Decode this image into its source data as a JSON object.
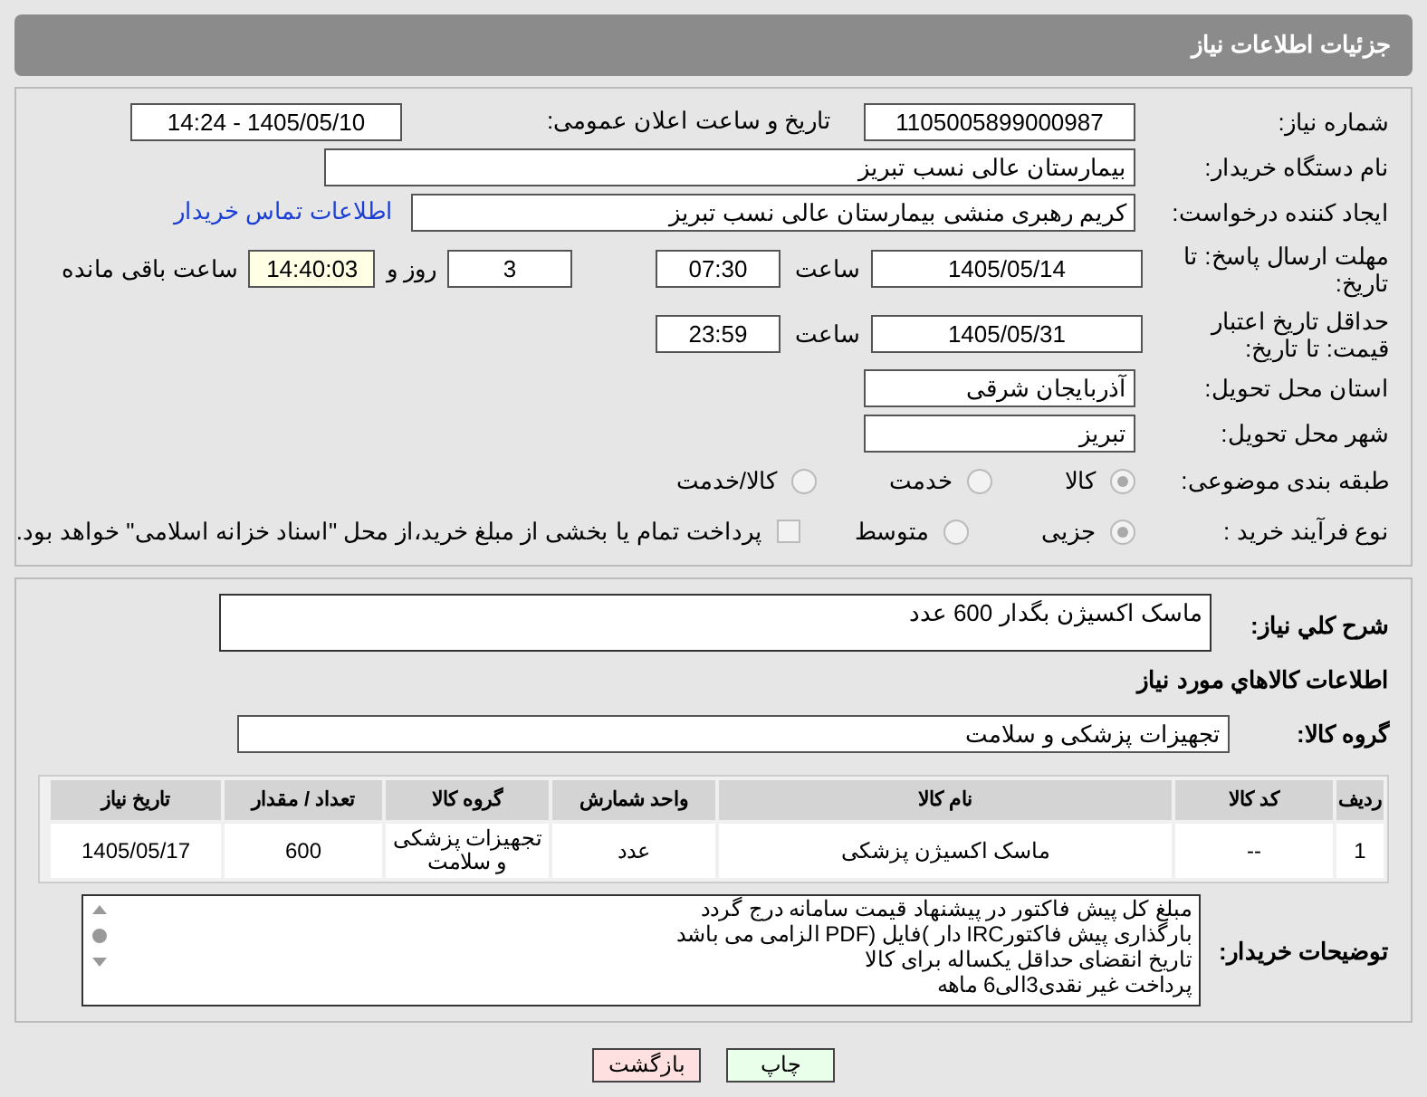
{
  "header": {
    "title": "جزئیات اطلاعات نیاز"
  },
  "details": {
    "need_number": {
      "label": "شماره نیاز:",
      "value": "1105005899000987"
    },
    "announce": {
      "label": "تاریخ و ساعت اعلان عمومی:",
      "value": "1405/05/10 - 14:24"
    },
    "buyer": {
      "label": "نام دستگاه خریدار:",
      "value": "بیمارستان عالی نسب تبریز"
    },
    "creator": {
      "label": "ایجاد کننده درخواست:",
      "value": "کریم رهبری منشی بیمارستان عالی نسب تبریز",
      "link": "اطلاعات تماس خریدار"
    },
    "deadline": {
      "label": "مهلت ارسال پاسخ: تا تاریخ:",
      "date": "1405/05/14",
      "time_label": "ساعت",
      "time": "07:30",
      "days": "3",
      "days_label": "روز و",
      "remaining": "14:40:03",
      "remaining_label": "ساعت باقی مانده"
    },
    "validity": {
      "label": "حداقل تاریخ اعتبار قیمت: تا تاریخ:",
      "date": "1405/05/31",
      "time_label": "ساعت",
      "time": "23:59"
    },
    "province": {
      "label": "استان محل تحویل:",
      "value": "آذربایجان شرقی"
    },
    "city": {
      "label": "شهر محل تحویل:",
      "value": "تبریز"
    },
    "category": {
      "label": "طبقه بندی موضوعی:",
      "options": [
        {
          "label": "کالا",
          "selected": true
        },
        {
          "label": "خدمت",
          "selected": false
        },
        {
          "label": "کالا/خدمت",
          "selected": false
        }
      ]
    },
    "process": {
      "label": "نوع فرآیند خرید :",
      "options": [
        {
          "label": "جزیی",
          "selected": true
        },
        {
          "label": "متوسط",
          "selected": false
        }
      ],
      "treasury": {
        "label": "پرداخت تمام یا بخشی از مبلغ خرید،از محل \"اسناد خزانه اسلامی\" خواهد بود.",
        "checked": false
      }
    }
  },
  "goods": {
    "description": {
      "label": "شرح کلي نياز:",
      "value": "ماسک اکسیژن بگدار 600 عدد"
    },
    "heading": "اطلاعات کالاهاي مورد نياز",
    "group": {
      "label": "گروه کالا:",
      "value": "تجهیزات پزشکی و سلامت"
    },
    "table": {
      "columns": [
        "ردیف",
        "کد کالا",
        "نام کالا",
        "واحد شمارش",
        "گروه کالا",
        "تعداد / مقدار",
        "تاریخ نیاز"
      ],
      "rows": [
        [
          "1",
          "--",
          "ماسک اکسیژن پزشکی",
          "عدد",
          "تجهیزات پزشکی و سلامت",
          "600",
          "1405/05/17"
        ]
      ]
    },
    "notes": {
      "label": "توضیحات خریدار:",
      "lines": [
        "مبلغ کل پیش فاکتور در پیشنهاد قیمت سامانه درج گردد",
        "بارگذاری پیش فاکتورIRC دار )فایل (PDF الزامی می باشد",
        "تاریخ انقضای حداقل یکساله برای کالا",
        "پرداخت غیر نقدی3الی6 ماهه"
      ]
    }
  },
  "buttons": [
    {
      "label": "چاپ",
      "kind": "print"
    },
    {
      "label": "بازگشت",
      "kind": "back"
    }
  ]
}
